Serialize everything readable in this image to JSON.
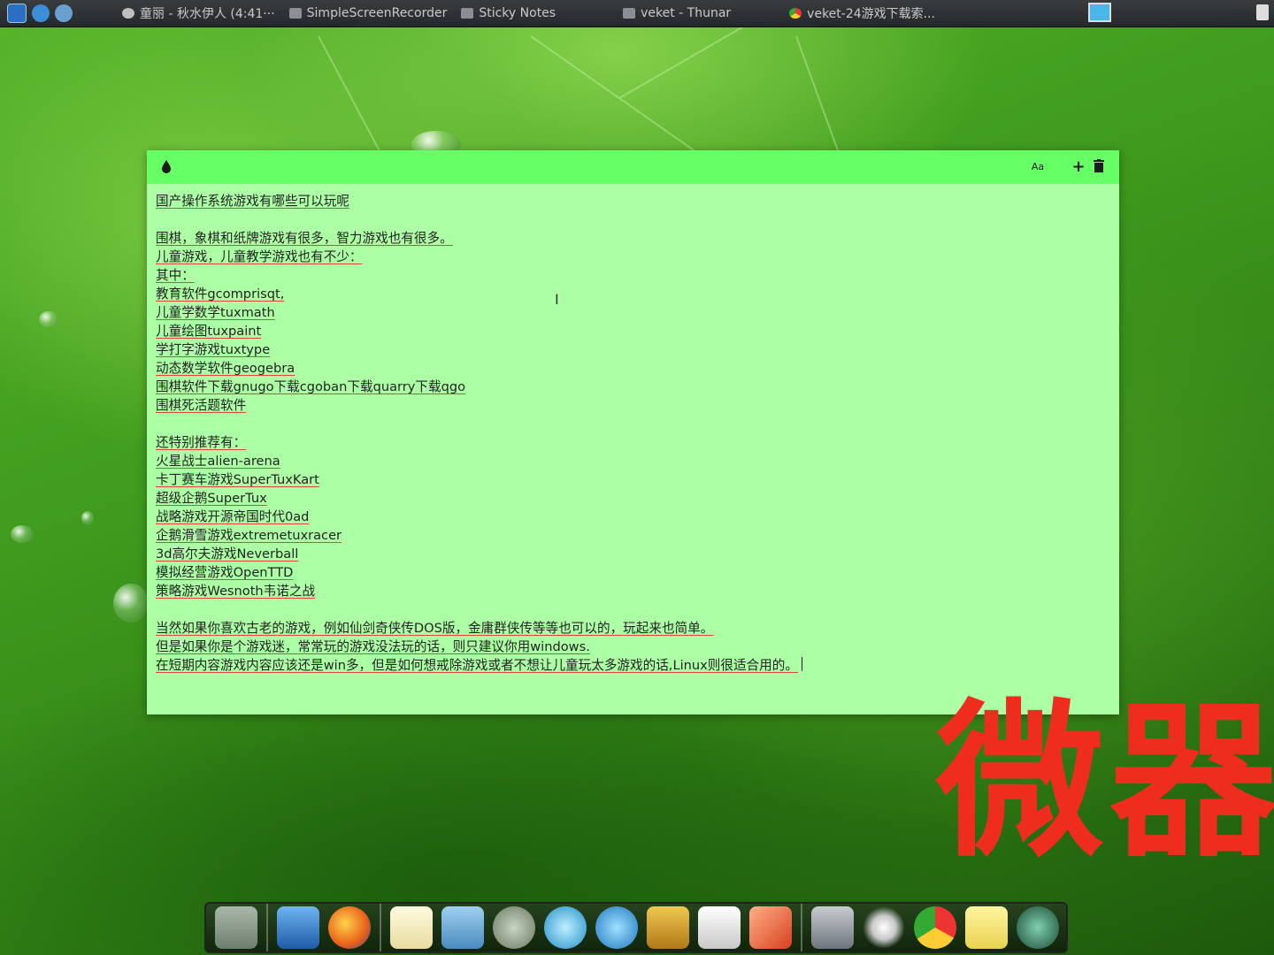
{
  "taskbar": {
    "tasks": [
      {
        "label": "童丽 - 秋水伊人 (4:41···",
        "icon": "media-player-icon"
      },
      {
        "label": "SimpleScreenRecorder",
        "icon": "window-icon"
      },
      {
        "label": "Sticky Notes",
        "icon": "window-icon"
      },
      {
        "label": "veket - Thunar",
        "icon": "folder-icon"
      },
      {
        "label": "veket-24游戏下载索...",
        "icon": "chrome-icon"
      }
    ]
  },
  "note": {
    "lines": [
      "国产操作系统游戏有哪些可以玩呢",
      "",
      "围棋，象棋和纸牌游戏有很多，智力游戏也有很多。",
      "儿童游戏，儿童教学游戏也有不少：",
      "其中：",
      "教育软件gcomprisqt,",
      "儿童学数学tuxmath",
      "儿童绘图tuxpaint",
      "学打字游戏tuxtype",
      "动态数学软件geogebra",
      "围棋软件下载gnugo下载cgoban下载quarry下载qgo",
      "围棋死活题软件",
      "",
      "还特别推荐有：",
      "火星战士alien-arena",
      "卡丁赛车游戏SuperTuxKart",
      "超级企鹅SuperTux",
      "战略游戏开源帝国时代0ad",
      "企鹅滑雪游戏extremetuxracer",
      "3d高尔夫游戏Neverball",
      "模拟经营游戏OpenTTD",
      "策略游戏Wesnoth韦诺之战",
      "",
      "当然如果你喜欢古老的游戏，例如仙剑奇侠传DOS版，金庸群侠传等等也可以的，玩起来也简单。",
      "但是如果你是个游戏迷，常常玩的游戏没法玩的话，则只建议你用windows.",
      "在短期内容游戏内容应该还是win多，但是如何想戒除游戏或者不想让儿童玩太多游戏的话,Linux则很适合用的。"
    ],
    "colors": {
      "header": "#66ff66",
      "body": "#adffa6"
    }
  },
  "watermark": {
    "text": "微器",
    "color": "#ee2d1f"
  },
  "dock": {
    "items": [
      {
        "name": "desktop-icon",
        "color": "#8a9a8a"
      },
      {
        "name": "computer-icon",
        "color": "#3b7bd3"
      },
      {
        "name": "firefox-icon",
        "color": "#e86a1a"
      },
      {
        "name": "text-editor-icon",
        "color": "#f2e9b0"
      },
      {
        "name": "image-viewer-icon",
        "color": "#6bb2e0"
      },
      {
        "name": "music-player-icon",
        "color": "#8fa08a"
      },
      {
        "name": "atom-icon",
        "color": "#3fb0d8"
      },
      {
        "name": "media-play-icon",
        "color": "#2ca3e0"
      },
      {
        "name": "notebook-icon",
        "color": "#e0b030"
      },
      {
        "name": "spreadsheet-icon",
        "color": "#e8e8e8"
      },
      {
        "name": "rocket-icon",
        "color": "#e04a2a"
      },
      {
        "name": "drive-icon",
        "color": "#9aa0a8"
      },
      {
        "name": "settings-sun-icon",
        "color": "#f0f0f0"
      },
      {
        "name": "chrome-icon",
        "color": "#d9d9d9"
      },
      {
        "name": "sticky-notes-icon",
        "color": "#f5e67a"
      },
      {
        "name": "globe-icon",
        "color": "#2a6a4a"
      }
    ]
  }
}
